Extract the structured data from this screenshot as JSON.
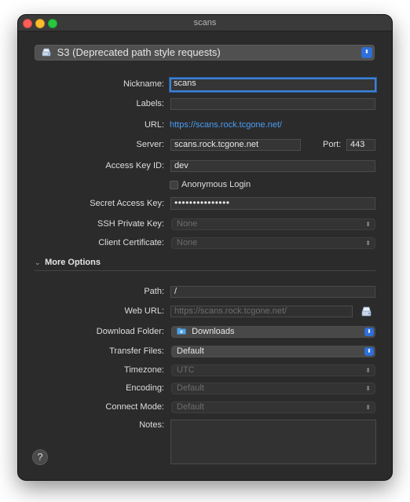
{
  "window": {
    "title": "scans"
  },
  "protocol": {
    "selected": "S3 (Deprecated path style requests)"
  },
  "form": {
    "nickname": {
      "label": "Nickname:",
      "value": "scans"
    },
    "labels": {
      "label": "Labels:",
      "value": ""
    },
    "url": {
      "label": "URL:",
      "value": "https://scans.rock.tcgone.net/"
    },
    "server": {
      "label": "Server:",
      "value": "scans.rock.tcgone.net"
    },
    "port": {
      "label": "Port:",
      "value": "443"
    },
    "access_key_id": {
      "label": "Access Key ID:",
      "value": "dev"
    },
    "anonymous_login": {
      "label": "Anonymous Login",
      "checked": false
    },
    "secret_access_key": {
      "label": "Secret Access Key:",
      "value": "•••••••••••••••"
    },
    "ssh_private_key": {
      "label": "SSH Private Key:",
      "value": "None"
    },
    "client_certificate": {
      "label": "Client Certificate:",
      "value": "None"
    }
  },
  "more_options": {
    "header": "More Options",
    "path": {
      "label": "Path:",
      "value": "/"
    },
    "web_url": {
      "label": "Web URL:",
      "placeholder": "https://scans.rock.tcgone.net/"
    },
    "download_folder": {
      "label": "Download Folder:",
      "value": "Downloads"
    },
    "transfer_files": {
      "label": "Transfer Files:",
      "value": "Default"
    },
    "timezone": {
      "label": "Timezone:",
      "value": "UTC"
    },
    "encoding": {
      "label": "Encoding:",
      "value": "Default"
    },
    "connect_mode": {
      "label": "Connect Mode:",
      "value": "Default"
    },
    "notes": {
      "label": "Notes:",
      "value": ""
    }
  },
  "help": {
    "glyph": "?"
  },
  "colors": {
    "window_bg": "#2b2b2b",
    "accent_blue": "#2e6fd9",
    "link": "#4a9cf5",
    "close": "#fe5f57",
    "minimize": "#febc2e",
    "maximize": "#28c840"
  }
}
